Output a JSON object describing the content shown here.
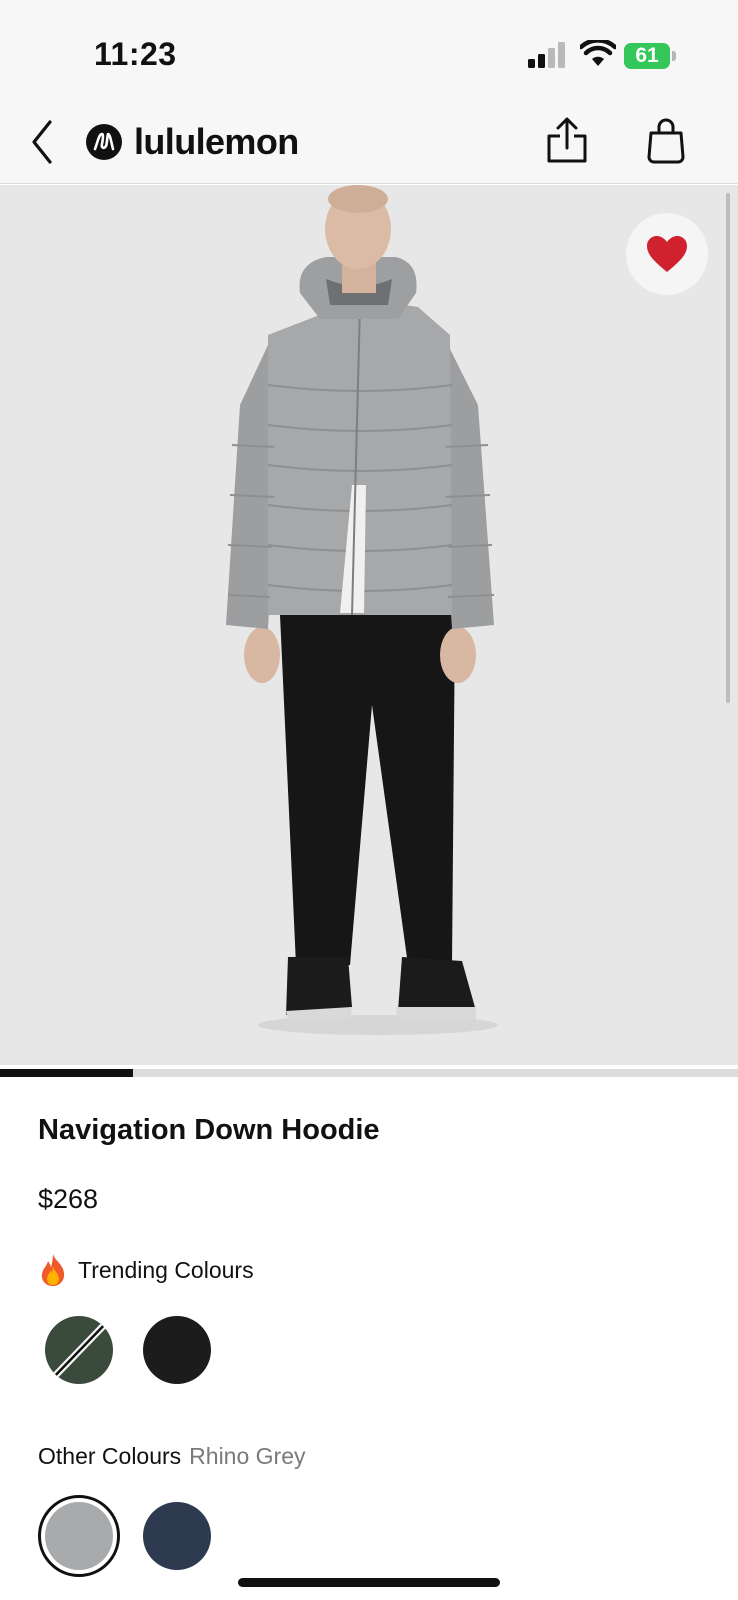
{
  "status_bar": {
    "time": "11:23",
    "battery": "61",
    "icons": [
      "signal-icon",
      "wifi-icon",
      "battery-charging-icon"
    ]
  },
  "header": {
    "brand": "lululemon",
    "icons": [
      "back-icon",
      "brand-logo-icon",
      "share-icon",
      "shopping-bag-icon"
    ]
  },
  "product": {
    "favorited": true,
    "carousel_progress": 0.18,
    "title": "Navigation Down Hoodie",
    "price": "$268"
  },
  "trending_colours": {
    "label": "Trending Colours",
    "icon": "fire-icon",
    "swatches": [
      {
        "color": "#3a4b3c",
        "sold_out": true
      },
      {
        "color": "#1c1c1c",
        "sold_out": false
      }
    ]
  },
  "other_colours": {
    "label": "Other Colours",
    "selected_name": "Rhino Grey",
    "swatches": [
      {
        "color": "#a9aaab",
        "selected": true
      },
      {
        "color": "#2d3a50",
        "selected": false
      }
    ]
  },
  "colors": {
    "accent": "#111111",
    "favorite_heart": "#d0212f",
    "battery": "#34c759"
  }
}
